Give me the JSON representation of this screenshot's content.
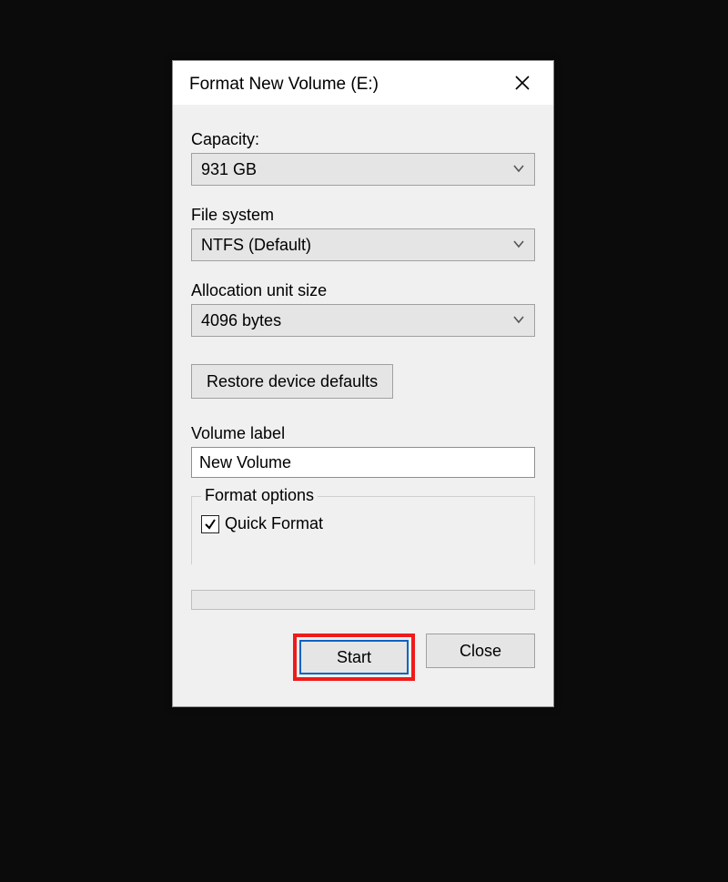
{
  "dialog": {
    "title": "Format New Volume (E:)"
  },
  "capacity": {
    "label": "Capacity:",
    "value": "931 GB"
  },
  "filesystem": {
    "label": "File system",
    "value": "NTFS (Default)"
  },
  "allocation": {
    "label": "Allocation unit size",
    "value": "4096 bytes"
  },
  "restore": {
    "label": "Restore device defaults"
  },
  "volume": {
    "label": "Volume label",
    "value": "New Volume"
  },
  "options": {
    "legend": "Format options",
    "quick_label": "Quick Format",
    "quick_checked": true
  },
  "buttons": {
    "start": "Start",
    "close": "Close"
  }
}
